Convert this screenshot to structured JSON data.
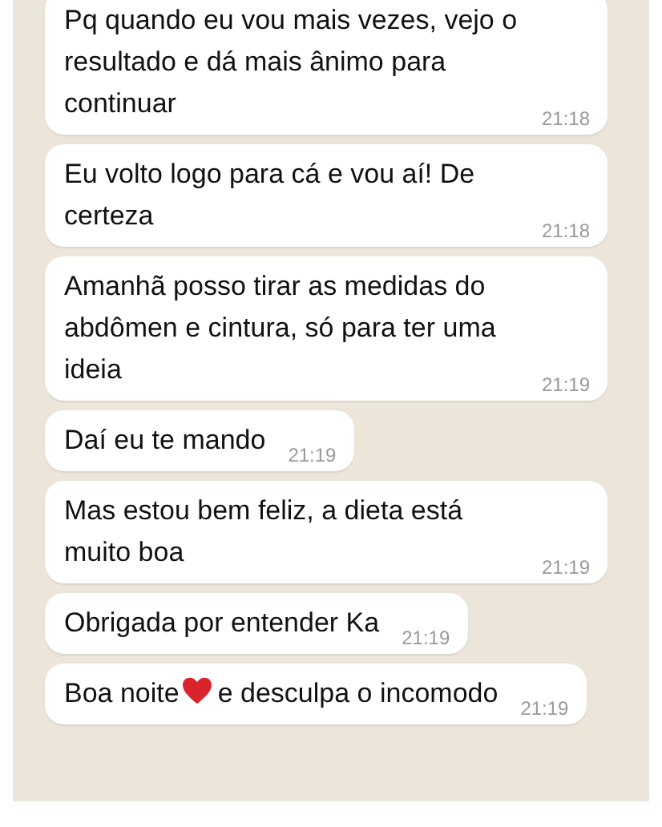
{
  "messages": [
    {
      "text": "Pq quando eu vou mais vezes, vejo o resultado e dá mais ânimo para continuar",
      "time": "21:18"
    },
    {
      "text": "Eu volto logo para cá e vou aí! De certeza",
      "time": "21:18"
    },
    {
      "text": "Amanhã posso tirar as medidas do abdômen e cintura, só para ter uma ideia",
      "time": "21:19"
    },
    {
      "text": "Daí eu te mando",
      "time": "21:19"
    },
    {
      "text": "Mas estou bem feliz, a dieta está muito boa",
      "time": "21:19"
    },
    {
      "text": "Obrigada por entender Ka",
      "time": "21:19"
    },
    {
      "text": "Boa noite",
      "after_heart": "e desculpa o incomodo",
      "time": "21:19"
    }
  ]
}
